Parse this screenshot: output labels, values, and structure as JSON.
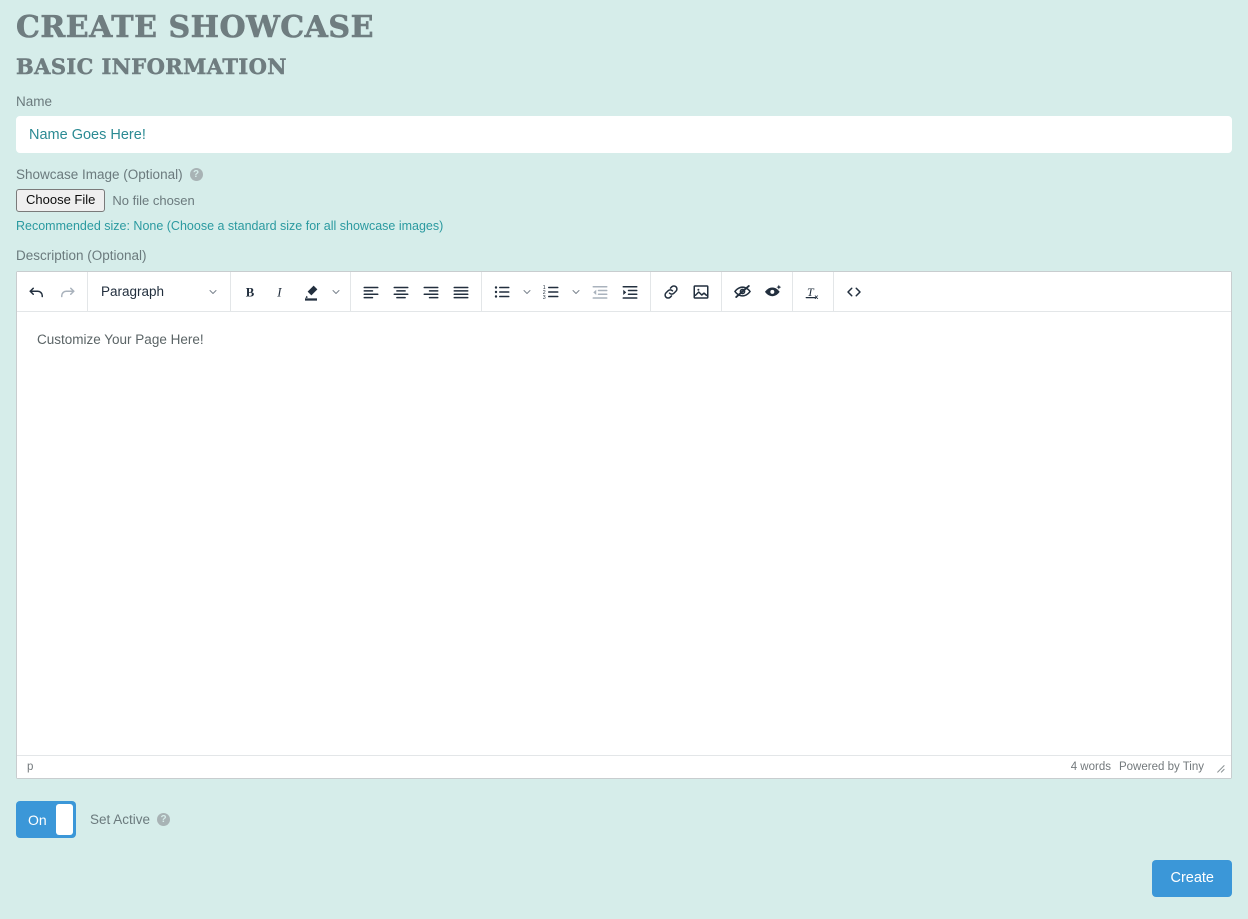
{
  "page": {
    "title": "Create Showcase",
    "section_title": "Basic Information"
  },
  "fields": {
    "name_label": "Name",
    "name_placeholder": "Name Goes Here!",
    "name_value": "",
    "image_label": "Showcase Image (Optional)",
    "image_help_icon": "help-circle-icon",
    "choose_file_label": "Choose File",
    "no_file_text": "No file chosen",
    "recommended_size": "Recommended size: None (Choose a standard size for all showcase images)",
    "description_label": "Description (Optional)"
  },
  "editor": {
    "placeholder": "Customize Your Page Here!",
    "format_select_value": "Paragraph",
    "status_path": "p",
    "word_count": "4 words",
    "branding": "Powered by Tiny",
    "resize_icon": "resize-handle-icon",
    "toolbar_groups": [
      {
        "name": "history",
        "items": [
          {
            "icon": "undo-icon",
            "label": "Undo",
            "state": "enabled"
          },
          {
            "icon": "redo-icon",
            "label": "Redo",
            "state": "disabled"
          }
        ]
      },
      {
        "name": "blocks",
        "items": [
          {
            "icon": "format-select",
            "label": "Paragraph",
            "state": "enabled"
          }
        ]
      },
      {
        "name": "formatting",
        "items": [
          {
            "icon": "bold-icon",
            "label": "Bold",
            "state": "enabled"
          },
          {
            "icon": "italic-icon",
            "label": "Italic",
            "state": "enabled"
          },
          {
            "icon": "highlight-pen-icon",
            "label": "Text color",
            "state": "enabled"
          },
          {
            "icon": "chevron-down-icon",
            "label": "Text color options",
            "state": "enabled"
          }
        ]
      },
      {
        "name": "alignment",
        "items": [
          {
            "icon": "align-left-icon",
            "label": "Align left",
            "state": "enabled"
          },
          {
            "icon": "align-center-icon",
            "label": "Align center",
            "state": "enabled"
          },
          {
            "icon": "align-right-icon",
            "label": "Align right",
            "state": "enabled"
          },
          {
            "icon": "align-justify-icon",
            "label": "Justify",
            "state": "enabled"
          }
        ]
      },
      {
        "name": "lists",
        "items": [
          {
            "icon": "bullet-list-icon",
            "label": "Bullet list",
            "state": "enabled"
          },
          {
            "icon": "chevron-down-icon",
            "label": "Bullet list options",
            "state": "enabled"
          },
          {
            "icon": "numbered-list-icon",
            "label": "Numbered list",
            "state": "enabled"
          },
          {
            "icon": "chevron-down-icon",
            "label": "Numbered list options",
            "state": "enabled"
          },
          {
            "icon": "outdent-icon",
            "label": "Decrease indent",
            "state": "disabled"
          },
          {
            "icon": "indent-icon",
            "label": "Increase indent",
            "state": "enabled"
          }
        ]
      },
      {
        "name": "insert",
        "items": [
          {
            "icon": "link-icon",
            "label": "Insert/edit link",
            "state": "enabled"
          },
          {
            "icon": "image-icon",
            "label": "Insert/edit image",
            "state": "enabled"
          }
        ]
      },
      {
        "name": "visibility",
        "items": [
          {
            "icon": "eye-off-icon",
            "label": "Hide",
            "state": "enabled"
          },
          {
            "icon": "eye-sparkle-icon",
            "label": "Show",
            "state": "enabled"
          }
        ]
      },
      {
        "name": "clear",
        "items": [
          {
            "icon": "clear-formatting-icon",
            "label": "Clear formatting",
            "state": "enabled"
          }
        ]
      },
      {
        "name": "source",
        "items": [
          {
            "icon": "source-code-icon",
            "label": "Source code",
            "state": "enabled"
          }
        ]
      }
    ]
  },
  "active_toggle": {
    "state_label": "On",
    "caption": "Set Active",
    "help_icon": "help-circle-icon"
  },
  "footer": {
    "create_label": "Create"
  },
  "colors": {
    "background": "#d6edea",
    "heading": "#6f7d80",
    "accent_blue": "#3b97d8",
    "link_teal": "#2b9aa0",
    "input_text": "#2b8a93",
    "toolbar_icon": "#222f3e",
    "disabled_icon": "#a9b2bc"
  }
}
